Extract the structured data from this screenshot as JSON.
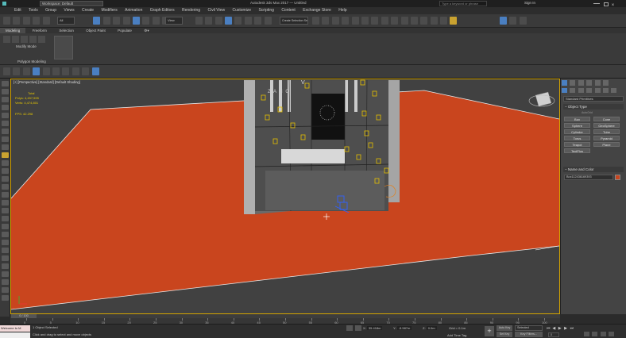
{
  "titlebar": {
    "workspace": "Workspace: Default",
    "app_title": "Autodesk 3ds Max 2017",
    "file_name": "Untitled",
    "search_placeholder": "Type a keyword or phrase",
    "sign_in": "Sign In"
  },
  "menu": [
    "Edit",
    "Tools",
    "Group",
    "Views",
    "Create",
    "Modifiers",
    "Animation",
    "Graph Editors",
    "Rendering",
    "Civil View",
    "Customize",
    "Scripting",
    "Content",
    "Exchange Store",
    "Help"
  ],
  "toolbar": {
    "filter_value": "All",
    "view_value": "View",
    "selection_set_placeholder": "Create Selection Se"
  },
  "ribbon": {
    "tabs": [
      "Modeling",
      "Freeform",
      "Selection",
      "Object Paint",
      "Populate"
    ],
    "modify_mode": "Modify Mode",
    "polygon_modeling": "Polygon Modeling"
  },
  "viewport": {
    "label": "[+] [Perspective] [Standard] [Default Shading]",
    "stats_total_label": "Total",
    "polys_label": "Polys:",
    "polys_value": "4,457,595",
    "verts_label": "Verts:",
    "verts_value": "4,474,801",
    "fps_label": "FPS:",
    "fps_value": "42.298",
    "sign_text": "Z A C O",
    "sign_letter": "V"
  },
  "command_panel": {
    "dropdown": "Standard Primitives",
    "object_type_title": "Object Type",
    "autogrid": "AutoGrid",
    "buttons": [
      "Box",
      "Cone",
      "Sphere",
      "GeoSphere",
      "Cylinder",
      "Tube",
      "Torus",
      "Pyramid",
      "Teapot",
      "Plane",
      "TextPlus"
    ],
    "name_color_title": "Name and Color",
    "object_name": "Box112436169393",
    "object_color": "#c9451e"
  },
  "timeline": {
    "frame_display": "0 / 100",
    "ticks": [
      "0",
      "5",
      "10",
      "15",
      "20",
      "25",
      "30",
      "35",
      "40",
      "45",
      "50",
      "55",
      "60",
      "65",
      "70",
      "75",
      "80",
      "85",
      "90",
      "95",
      "100"
    ]
  },
  "status": {
    "maxscript": "Welcome to M",
    "selected": "1 Object Selected",
    "hint": "Click and drag to select and move objects",
    "x_label": "X:",
    "x_value": "35.418m",
    "y_label": "Y:",
    "y_value": "-5.587m",
    "z_label": "Z:",
    "z_value": "0.0m",
    "grid": "Grid = 0.1m",
    "add_time_tag": "Add Time Tag",
    "autokey": "Auto Key",
    "setkey": "Set Key",
    "selected_dropdown": "Selected",
    "key_filters": "Key Filters...",
    "frame_value": "0"
  },
  "colors": {
    "ground": "#c9451e",
    "viewport_bg": "#414141",
    "accent": "#d4a400",
    "active_button": "#4a7fc1"
  }
}
